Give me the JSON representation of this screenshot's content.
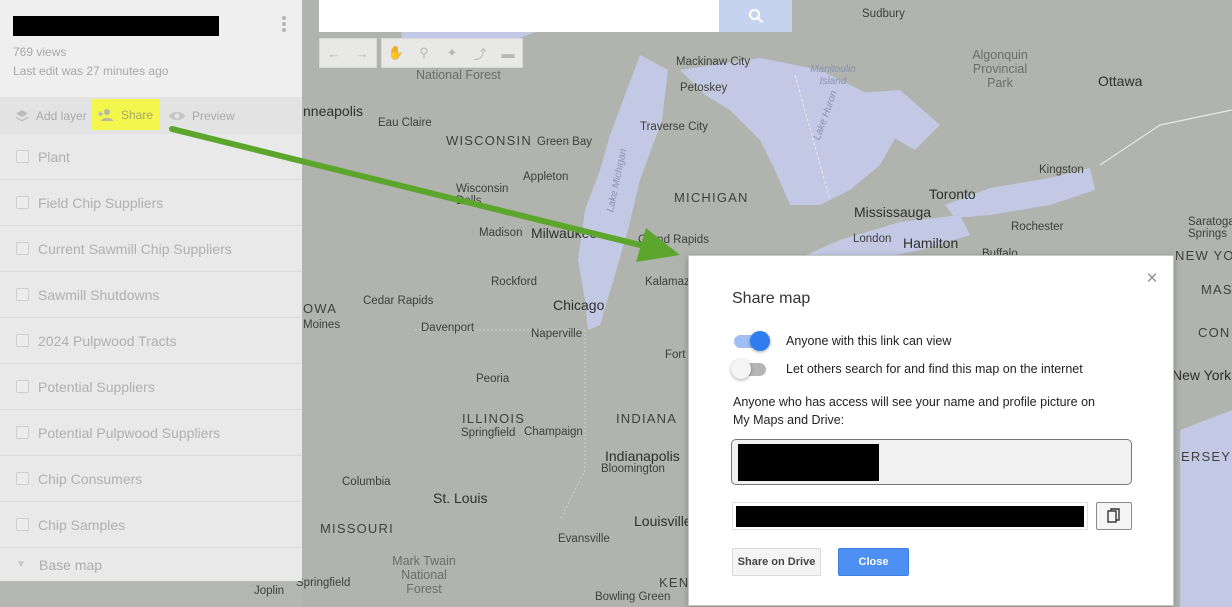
{
  "colors": {
    "accent_blue": "#4d8ff3",
    "highlight_yellow": "#f3f74d",
    "arrow_green": "#5ca62d",
    "map_water": "#c3c9e4"
  },
  "panel": {
    "views": "769 views",
    "last_edit": "Last edit was 27 minutes ago",
    "actions": {
      "add_layer": "Add layer",
      "share": "Share",
      "preview": "Preview"
    },
    "layers": [
      "Plant",
      "Field Chip Suppliers",
      "Current Sawmill Chip Suppliers",
      "Sawmill Shutdowns",
      "2024 Pulpwood Tracts",
      "Potential Suppliers",
      "Potential Pulpwood Suppliers",
      "Chip Consumers",
      "Chip Samples"
    ],
    "base_map": "Base map"
  },
  "toolbar": {
    "icons": [
      "undo-icon",
      "redo-icon",
      "hand-icon",
      "marker-icon",
      "draw-line-icon",
      "directions-icon",
      "ruler-icon"
    ]
  },
  "map": {
    "labels": [
      {
        "text": "Sudbury",
        "kind": "city"
      },
      {
        "text": "National Forest",
        "kind": "park"
      },
      {
        "text": "Mackinaw City",
        "kind": "city"
      },
      {
        "text": "Algonquin Provincial Park",
        "kind": "park"
      },
      {
        "text": "Ottawa",
        "kind": "big"
      },
      {
        "text": "Manitoulin Island",
        "kind": "water"
      },
      {
        "text": "Petoskey",
        "kind": "city"
      },
      {
        "text": "Lake Huron",
        "kind": "water"
      },
      {
        "text": "nneapolis",
        "kind": "big"
      },
      {
        "text": "Eau Claire",
        "kind": "city"
      },
      {
        "text": "Traverse City",
        "kind": "city"
      },
      {
        "text": "WISCONSIN",
        "kind": "state"
      },
      {
        "text": "Green Bay",
        "kind": "city"
      },
      {
        "text": "Lake Michigan",
        "kind": "water"
      },
      {
        "text": "Appleton",
        "kind": "city"
      },
      {
        "text": "Kingston",
        "kind": "city"
      },
      {
        "text": "Wisconsin Dells",
        "kind": "city"
      },
      {
        "text": "MICHIGAN",
        "kind": "state"
      },
      {
        "text": "Toronto",
        "kind": "big"
      },
      {
        "text": "Mississauga",
        "kind": "big"
      },
      {
        "text": "Rochester",
        "kind": "city"
      },
      {
        "text": "Saratoga Springs",
        "kind": "city"
      },
      {
        "text": "Madison",
        "kind": "city"
      },
      {
        "text": "Milwaukee",
        "kind": "big"
      },
      {
        "text": "Grand Rapids",
        "kind": "city"
      },
      {
        "text": "London",
        "kind": "city"
      },
      {
        "text": "Hamilton",
        "kind": "big"
      },
      {
        "text": "NEW YORK",
        "kind": "state"
      },
      {
        "text": "Rockford",
        "kind": "city"
      },
      {
        "text": "Cedar Rapids",
        "kind": "city"
      },
      {
        "text": "Chicago",
        "kind": "big"
      },
      {
        "text": "Kalamazoo",
        "kind": "city"
      },
      {
        "text": "Davenport",
        "kind": "city"
      },
      {
        "text": "Naperville",
        "kind": "city"
      },
      {
        "text": "OWA",
        "kind": "state"
      },
      {
        "text": "Moines",
        "kind": "city"
      },
      {
        "text": "Peoria",
        "kind": "city"
      },
      {
        "text": "Fort",
        "kind": "city"
      },
      {
        "text": "MAS",
        "kind": "state"
      },
      {
        "text": "CON",
        "kind": "state"
      },
      {
        "text": "New York",
        "kind": "big"
      },
      {
        "text": "ILLINOIS",
        "kind": "state"
      },
      {
        "text": "Springfield",
        "kind": "city"
      },
      {
        "text": "Champaign",
        "kind": "city"
      },
      {
        "text": "INDIANA",
        "kind": "state"
      },
      {
        "text": "Indianapolis",
        "kind": "big"
      },
      {
        "text": "Bloomington",
        "kind": "city"
      },
      {
        "text": "ERSEY",
        "kind": "state"
      },
      {
        "text": "Columbia",
        "kind": "city"
      },
      {
        "text": "St. Louis",
        "kind": "big"
      },
      {
        "text": "MISSOURI",
        "kind": "state"
      },
      {
        "text": "Louisville",
        "kind": "big"
      },
      {
        "text": "Evansville",
        "kind": "city"
      },
      {
        "text": "Mark Twain National Forest",
        "kind": "park"
      },
      {
        "text": "Springfield",
        "kind": "city"
      },
      {
        "text": "Joplin",
        "kind": "city"
      },
      {
        "text": "KEN",
        "kind": "state"
      },
      {
        "text": "Bowling Green",
        "kind": "city"
      },
      {
        "text": "Buffalo",
        "kind": "city"
      }
    ]
  },
  "dialog": {
    "title": "Share map",
    "close_icon": "×",
    "link_view_label": "Anyone with this link can view",
    "link_view_on": true,
    "search_label": "Let others search for and find this map on the internet",
    "search_on": false,
    "access_note": "Anyone who has access will see your name and profile picture on My Maps and Drive:",
    "share_on_drive": "Share on Drive",
    "close": "Close"
  }
}
